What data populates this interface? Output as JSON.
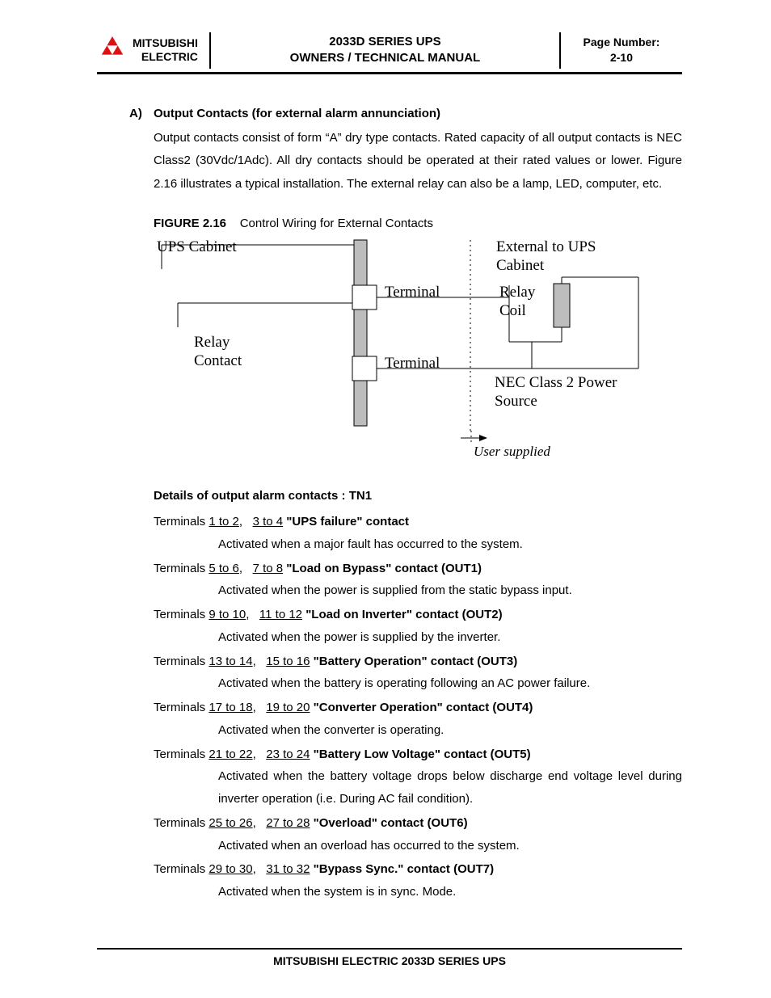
{
  "header": {
    "brand_line1": "MITSUBISHI",
    "brand_line2": "ELECTRIC",
    "title_line1": "2033D SERIES UPS",
    "title_line2": "OWNERS / TECHNICAL MANUAL",
    "page_label": "Page Number:",
    "page_number": "2-10"
  },
  "section": {
    "marker": "A)",
    "title": "Output Contacts (for external alarm annunciation)",
    "body": "Output contacts consist of form “A” dry type contacts. Rated capacity of all output contacts is NEC Class2 (30Vdc/1Adc). All dry contacts should be operated at their rated values or lower. Figure 2.16 illustrates a typical installation. The external relay can also be a lamp, LED, computer, etc."
  },
  "figure": {
    "label": "FIGURE 2.16",
    "caption": "Control Wiring for External Contacts",
    "labels": {
      "ups_cabinet": "UPS Cabinet",
      "external": "External to UPS Cabinet",
      "terminal1": "Terminal",
      "terminal2": "Terminal",
      "relay_contact": "Relay Contact",
      "relay_coil": "Relay Coil",
      "nec": "NEC Class 2 Power Source",
      "user_supplied": "User supplied"
    }
  },
  "details_heading": "Details of output alarm contacts : TN1",
  "terminals": [
    {
      "prefix": "Terminals",
      "r1": "1 to 2",
      "r2": "3 to 4",
      "name": "\"UPS failure\" contact",
      "desc": "Activated when a major fault has occurred to the system."
    },
    {
      "prefix": "Terminals",
      "r1": "5 to 6",
      "r2": "7 to 8",
      "name": "\"Load on Bypass\" contact (OUT1)",
      "desc": "Activated when the power is supplied from the static bypass input."
    },
    {
      "prefix": "Terminals",
      "r1": "9 to 10",
      "r2": "11 to 12",
      "name": "\"Load on Inverter\" contact (OUT2)",
      "desc": "Activated when the power is supplied by the inverter."
    },
    {
      "prefix": "Terminals",
      "r1": "13 to 14",
      "r2": "15 to 16",
      "name": "\"Battery Operation\" contact (OUT3)",
      "desc": "Activated when the battery is operating following an AC power failure."
    },
    {
      "prefix": "Terminals",
      "r1": "17 to 18",
      "r2": "19 to 20",
      "name": "\"Converter Operation\" contact (OUT4)",
      "desc": "Activated when the converter is operating."
    },
    {
      "prefix": "Terminals",
      "r1": "21 to 22",
      "r2": "23 to 24",
      "name": "\"Battery Low Voltage\" contact (OUT5)",
      "desc": "Activated when the battery voltage drops below discharge end voltage level during inverter operation (i.e. During AC fail condition)."
    },
    {
      "prefix": "Terminals",
      "r1": "25 to 26",
      "r2": "27 to 28",
      "name": "\"Overload\" contact (OUT6)",
      "desc": "Activated when an overload has occurred to the system."
    },
    {
      "prefix": "Terminals",
      "r1": "29 to 30",
      "r2": "31 to 32",
      "name": "\"Bypass Sync.\" contact (OUT7)",
      "desc": "Activated when the system is in sync. Mode."
    }
  ],
  "footer": "MITSUBISHI ELECTRIC 2033D SERIES UPS"
}
